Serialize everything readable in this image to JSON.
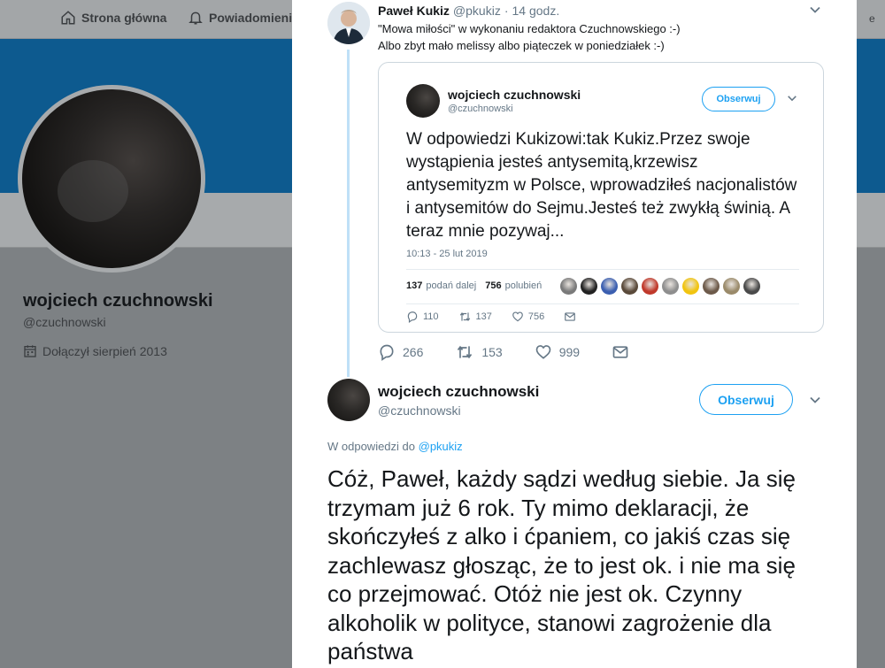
{
  "topnav": {
    "home_label": "Strona główna",
    "notifications_label": "Powiadomienia",
    "right_fragment": "e"
  },
  "profile": {
    "name": "wojciech czuchnowski",
    "handle": "@czuchnowski",
    "joined": "Dołączył sierpień 2013"
  },
  "parent_tweet": {
    "author_name": "Paweł Kukiz",
    "author_handle": "@pkukiz",
    "separator": "·",
    "time": "14 godz.",
    "text_line1": "\"Mowa miłości\" w wykonaniu redaktora Czuchnowskiego :-)",
    "text_line2": "Albo zbyt mało melissy albo piąteczek w poniedziałek :-)",
    "replies": "266",
    "retweets": "153",
    "likes": "999"
  },
  "quoted_tweet": {
    "author_name": "wojciech czuchnowski",
    "author_handle": "@czuchnowski",
    "follow_label": "Obserwuj",
    "text": "W odpowiedzi Kukizowi:tak Kukiz.Przez swoje wystąpienia jesteś  antysemitą,krzewisz antysemityzm w Polsce, wprowadziłeś nacjonalistów i antysemitów do Sejmu.Jesteś też zwykłą świnią. A teraz mnie pozywaj...",
    "timestamp": "10:13 - 25 lut 2019",
    "retweet_count": "137",
    "retweet_label": "podań dalej",
    "like_count": "756",
    "like_label": "polubień",
    "replies": "110",
    "retweets": "137",
    "likes": "756",
    "face_colors": [
      "#7a7a7a",
      "#222222",
      "#3b5fb0",
      "#5a4a3a",
      "#c0392b",
      "#8e8e8e",
      "#f1c40f",
      "#6d5a4a",
      "#9a8a6a",
      "#4a4a4a"
    ]
  },
  "reply_tweet": {
    "author_name": "wojciech czuchnowski",
    "author_handle": "@czuchnowski",
    "follow_label": "Obserwuj",
    "context_prefix": "W odpowiedzi do",
    "context_mention": "@pkukiz",
    "text": "Cóż, Paweł, każdy sądzi według siebie. Ja się trzymam  już 6 rok. Ty mimo deklaracji, że skończyłeś z alko i ćpaniem, co jakiś czas się zachlewasz głosząc, że to jest ok. i nie ma się co przejmować. Otóż nie jest ok. Czynny alkoholik w polityce, stanowi zagrożenie dla państwa"
  },
  "colors": {
    "accent": "#1da1f2",
    "banner": "#0d5a8f",
    "overlay_bg": "#7d8184",
    "thread_line": "#bfe0f7"
  }
}
